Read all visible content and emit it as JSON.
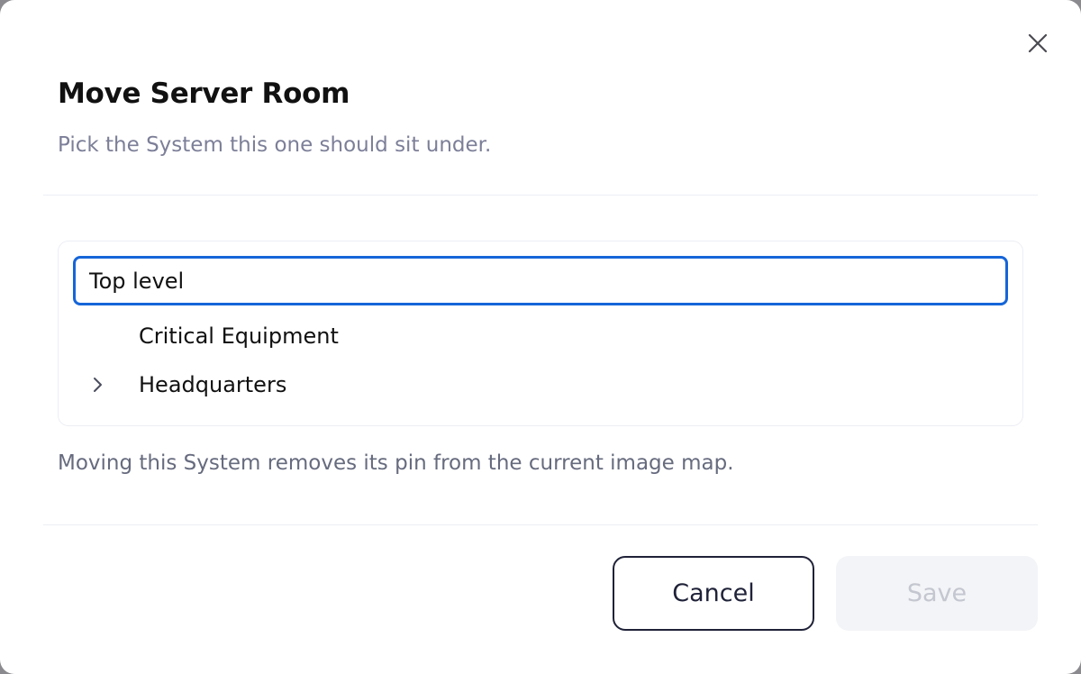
{
  "dialog": {
    "title": "Move Server Room",
    "subtitle": "Pick the System this one should sit under.",
    "close_icon": "close-icon"
  },
  "tree": {
    "items": [
      {
        "label": "Top level",
        "selected": true,
        "expandable": false
      },
      {
        "label": "Critical Equipment",
        "selected": false,
        "expandable": false
      },
      {
        "label": "Headquarters",
        "selected": false,
        "expandable": true,
        "icon": "chevron-right-icon"
      }
    ]
  },
  "note": "Moving this System removes its pin from the current image map.",
  "actions": {
    "cancel_label": "Cancel",
    "save_label": "Save",
    "save_disabled": true
  },
  "colors": {
    "selected_border": "#1565d8",
    "cancel_border": "#1f2238",
    "save_disabled_bg": "#f3f4f7"
  }
}
